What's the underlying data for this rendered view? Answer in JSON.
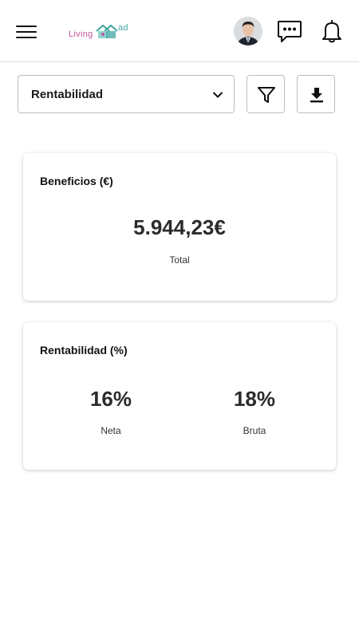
{
  "header": {
    "logo": {
      "part1": "Living",
      "part2": "ad"
    },
    "colors": {
      "logo_primary": "#c2559a",
      "logo_secondary": "#3fa6a1",
      "divider": "#dcdcdc"
    },
    "icons": [
      "menu-icon",
      "chat-icon",
      "bell-icon"
    ]
  },
  "filters": {
    "selected": "Rentabilidad",
    "filter_icon": "filter-icon",
    "download_icon": "download-icon"
  },
  "cards": {
    "beneficios": {
      "title": "Beneficios (€)",
      "value": "5.944,23€",
      "label": "Total"
    },
    "rentabilidad": {
      "title": "Rentabilidad (%)",
      "neta_value": "16%",
      "neta_label": "Neta",
      "bruta_value": "18%",
      "bruta_label": "Bruta"
    }
  }
}
